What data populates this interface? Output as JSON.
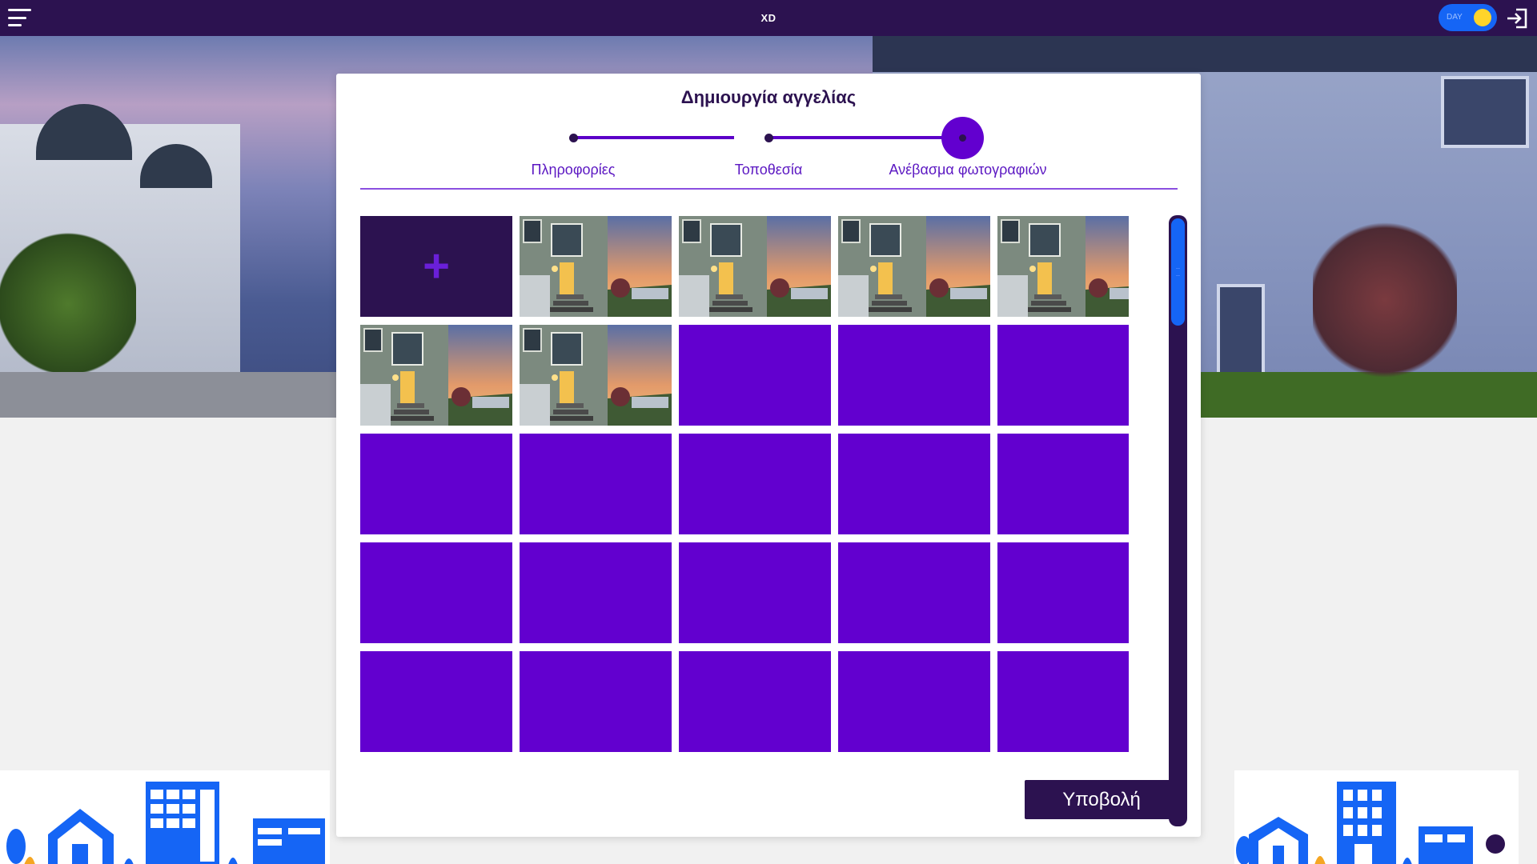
{
  "topbar": {
    "brand": "XD",
    "menu_icon": "hamburger-menu-icon",
    "theme_toggle": {
      "label": "DAY",
      "state": "on",
      "color": "#1565f5",
      "knob_color": "#ffd42a"
    },
    "login_icon": "login-icon"
  },
  "modal": {
    "title": "Δημιουργία αγγελίας",
    "steps": [
      {
        "label": "Πληροφορίες",
        "completed": true
      },
      {
        "label": "Τοποθεσία",
        "completed": true
      },
      {
        "label": "Ανέβασμα φωτογραφιών",
        "active": true
      }
    ],
    "gallery": {
      "add_tile": {
        "icon": "plus-icon",
        "glyph": "+"
      },
      "uploaded_photos": 6,
      "empty_slots": 18,
      "columns": 5
    },
    "submit_label": "Υποβολή"
  },
  "colors": {
    "primary_dark": "#2c1250",
    "accent_purple": "#6200cf",
    "link_purple": "#5b17c2",
    "scroll_blue": "#1565f5"
  }
}
